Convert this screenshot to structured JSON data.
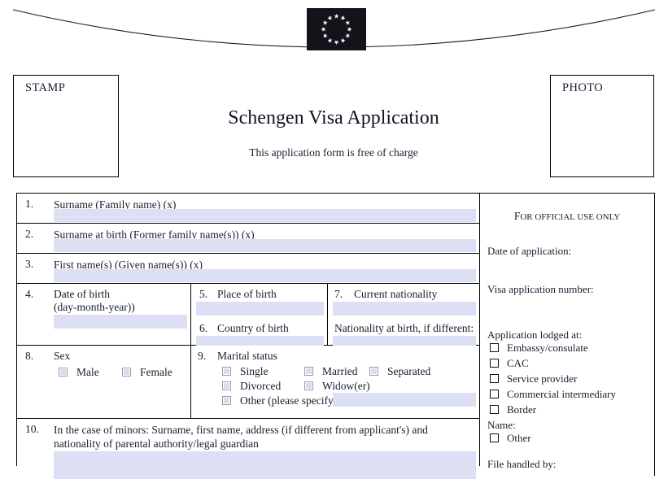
{
  "header": {
    "flag_alt": "european-union-flag",
    "stamp_label": "STAMP",
    "photo_label": "PHOTO",
    "title": "Schengen Visa Application",
    "subtitle": "This application form is free of charge"
  },
  "colors": {
    "field_fill": "#dde0f4",
    "checkbox_fill": "#d9dcf0",
    "border": "#000000",
    "text": "#1b1b30",
    "flag_background": "#13131b",
    "flag_stars": "#ffffff"
  },
  "form": {
    "rows": [
      {
        "num": "1.",
        "label": "Surname (Family name) (x)",
        "value": ""
      },
      {
        "num": "2.",
        "label": "Surname at birth (Former family name(s)) (x)",
        "value": ""
      },
      {
        "num": "3.",
        "label": "First name(s) (Given name(s)) (x)",
        "value": ""
      }
    ],
    "birth_block": {
      "dob": {
        "num": "4.",
        "label_line1": "Date of birth",
        "label_line2": "(day-month-year))",
        "value": ""
      },
      "place_of_birth": {
        "num": "5.",
        "label": "Place of birth",
        "value": ""
      },
      "country_of_birth": {
        "num": "6.",
        "label": "Country of birth",
        "value": ""
      },
      "current_nationality": {
        "num": "7.",
        "label": "Current nationality",
        "value": ""
      },
      "nationality_at_birth": {
        "label": "Nationality at birth, if different:",
        "value": ""
      }
    },
    "sex": {
      "num": "8.",
      "label": "Sex",
      "options": [
        {
          "label": "Male",
          "checked": false
        },
        {
          "label": "Female",
          "checked": false
        }
      ]
    },
    "marital_status": {
      "num": "9.",
      "label": "Marital status",
      "options": [
        {
          "label": "Single",
          "checked": false
        },
        {
          "label": "Married",
          "checked": false
        },
        {
          "label": "Separated",
          "checked": false
        },
        {
          "label": "Divorced",
          "checked": false
        },
        {
          "label": "Widow(er)",
          "checked": false
        },
        {
          "label": "Other (please specify)",
          "checked": false
        }
      ],
      "other_value": ""
    },
    "minors": {
      "num": "10.",
      "label": "In the case of minors: Surname, first name, address (if different from applicant's) and nationality of parental authority/legal guardian",
      "value": ""
    }
  },
  "official": {
    "title_first": "F",
    "title_rest": "OR OFFICIAL USE ONLY",
    "date_of_application": "Date of application:",
    "visa_application_number": "Visa application number:",
    "application_lodged_at": "Application lodged at:",
    "lodged_options": [
      {
        "label": "Embassy/consulate",
        "checked": false
      },
      {
        "label": "CAC",
        "checked": false
      },
      {
        "label": "Service provider",
        "checked": false
      },
      {
        "label": "Commercial intermediary",
        "checked": false
      },
      {
        "label": "Border",
        "checked": false
      }
    ],
    "name_label": "Name:",
    "other_option": {
      "label": "Other",
      "checked": false
    },
    "file_handled_by": "File handled by:"
  }
}
